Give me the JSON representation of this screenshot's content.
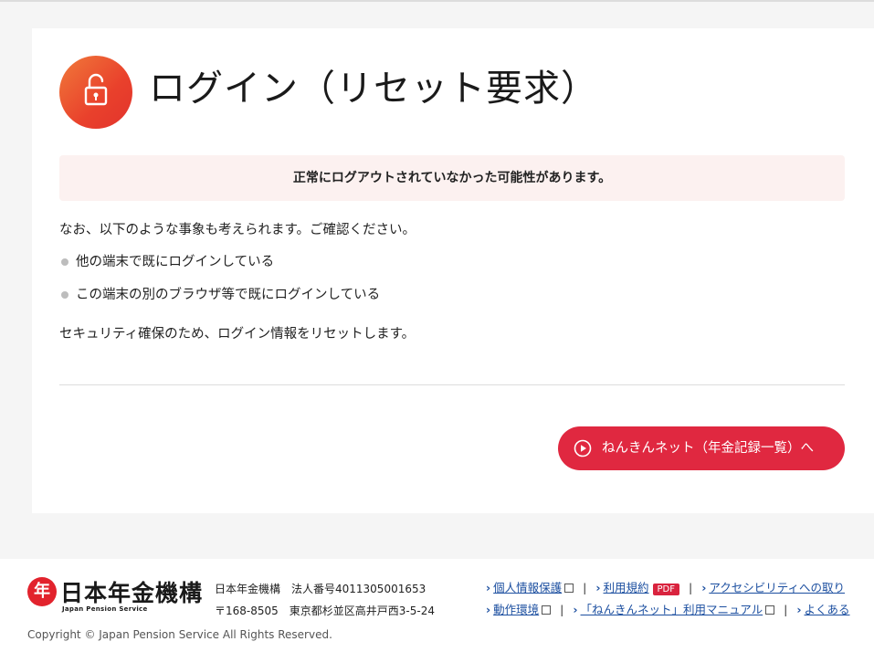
{
  "page": {
    "title": "ログイン（リセット要求）",
    "alert": "正常にログアウトされていなかった可能性があります。",
    "intro": "なお、以下のような事象も考えられます。ご確認ください。",
    "items": [
      "他の端末で既にログインしている",
      "この端末の別のブラウザ等で既にログインしている"
    ],
    "outro": "セキュリティ確保のため、ログイン情報をリセットします。",
    "button_label": "ねんきんネット（年金記録一覧）へ",
    "button_chevron": "へ",
    "lock_icon": "unlock-icon"
  },
  "colors": {
    "accent": "#e02840",
    "alert_bg": "#fcf1f0",
    "lock_grad_start": "#f07a3a",
    "lock_grad_end": "#e2332d"
  },
  "footer": {
    "logo_mark": "年",
    "logo_jp": "日本年金機構",
    "logo_en": "Japan Pension Service",
    "org_line1": "日本年金機構　法人番号4011305001653",
    "org_line2": "〒168-8505　東京都杉並区高井戸西3-5-24",
    "links_row1": [
      {
        "label": "個人情報保護",
        "ext": true,
        "pdf": false
      },
      {
        "label": "利用規約",
        "ext": false,
        "pdf": true
      },
      {
        "label": "アクセシビリティへの取り",
        "ext": false,
        "pdf": false
      }
    ],
    "links_row2": [
      {
        "label": "動作環境",
        "ext": true,
        "pdf": false
      },
      {
        "label": "「ねんきんネット」利用マニュアル",
        "ext": true,
        "pdf": false
      },
      {
        "label": "よくある",
        "ext": false,
        "pdf": false
      }
    ],
    "pdf_badge": "PDF",
    "copyright": "Copyright © Japan Pension Service All Rights Reserved."
  }
}
